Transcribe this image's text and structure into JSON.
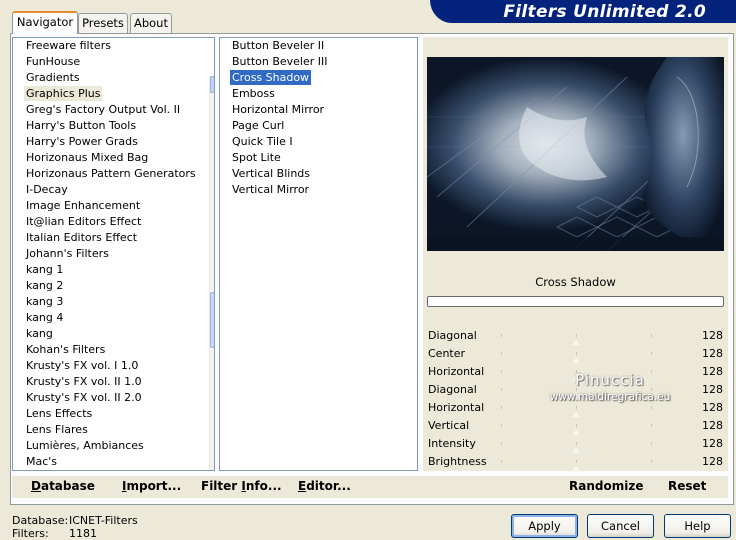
{
  "app": {
    "title": "Filters Unlimited 2.0"
  },
  "tabs": [
    {
      "label": "Navigator"
    },
    {
      "label": "Presets"
    },
    {
      "label": "About"
    }
  ],
  "categories": {
    "items": [
      "Freeware filters",
      "FunHouse",
      "Gradients",
      "Graphics Plus",
      "Greg's Factory Output Vol. II",
      "Harry's Button Tools",
      "Harry's Power Grads",
      "Horizonaus Mixed Bag",
      "Horizonaus Pattern Generators",
      "I-Decay",
      "Image Enhancement",
      "It@lian Editors Effect",
      "Italian Editors Effect",
      "Johann's Filters",
      "kang 1",
      "kang 2",
      "kang 3",
      "kang 4",
      "kang",
      "Kohan's Filters",
      "Krusty's FX vol. I 1.0",
      "Krusty's FX vol. II 1.0",
      "Krusty's FX vol. II 2.0",
      "Lens Effects",
      "Lens Flares",
      "Lumières, Ambiances",
      "Mac's"
    ],
    "selected": "Graphics Plus"
  },
  "filters": {
    "items": [
      "Button Beveler II",
      "Button Beveler III",
      "Cross Shadow",
      "Emboss",
      "Horizontal Mirror",
      "Page Curl",
      "Quick Tile I",
      "Spot Lite",
      "Vertical Blinds",
      "Vertical Mirror"
    ],
    "selected": "Cross Shadow"
  },
  "preview": {
    "label": "Cross Shadow",
    "progress": 0
  },
  "parameters": [
    {
      "name": "Diagonal",
      "value": "128"
    },
    {
      "name": "Center",
      "value": "128"
    },
    {
      "name": "Horizontal",
      "value": "128"
    },
    {
      "name": "Diagonal",
      "value": "128"
    },
    {
      "name": "Horizontal",
      "value": "128"
    },
    {
      "name": "Vertical",
      "value": "128"
    },
    {
      "name": "Intensity",
      "value": "128"
    },
    {
      "name": "Brightness",
      "value": "128"
    }
  ],
  "watermark": {
    "name": "Pinuccia",
    "url": "www.maidiregrafica.eu"
  },
  "toolbar": {
    "database": {
      "first": "D",
      "rest": "atabase"
    },
    "import": {
      "first": "I",
      "rest": "mport..."
    },
    "filter_info": {
      "a": "Filter ",
      "u": "I",
      "b": "nfo..."
    },
    "editor": {
      "first": "E",
      "rest": "ditor..."
    },
    "randomize": "Randomize",
    "reset": "Reset"
  },
  "status": {
    "database_label": "Database:",
    "database_value": "ICNET-Filters",
    "filters_label": "Filters:",
    "filters_value": "1181"
  },
  "buttons": {
    "apply": "Apply",
    "cancel": "Cancel",
    "help": "Help"
  },
  "colors": {
    "title_banner": "#04237d",
    "selection": "#316ac5",
    "window_bg": "#ece9d8"
  }
}
